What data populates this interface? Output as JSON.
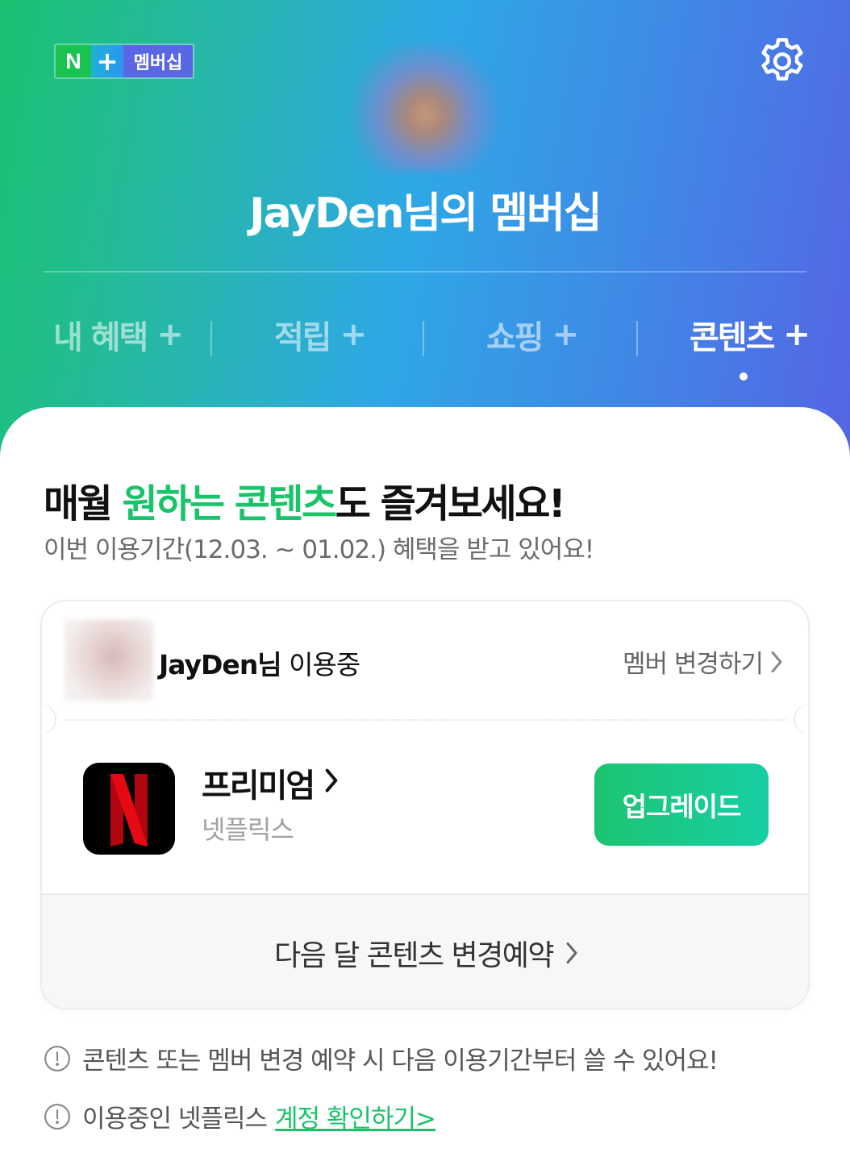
{
  "header": {
    "brand": {
      "n": "N",
      "plus": "+",
      "text": "멤버십"
    },
    "title": "JayDen님의 멤버십",
    "tabs": [
      {
        "label": "내 혜택",
        "plus": "+"
      },
      {
        "label": "적립",
        "plus": "+"
      },
      {
        "label": "쇼핑",
        "plus": "+"
      },
      {
        "label": "콘텐츠",
        "plus": "+",
        "active": true
      }
    ]
  },
  "content": {
    "headline_part1": "매월 ",
    "headline_highlight": "원하는 콘텐츠",
    "headline_part2": "도 즐겨보세요!",
    "subline": "이번 이용기간(12.03. ~ 01.02.) 혜택을 받고 있어요!",
    "card": {
      "member_name": "JayDen님",
      "member_status": " 이용중",
      "change_member": "멤버 변경하기",
      "plan_name": "프리미엄",
      "service_name": "넷플릭스",
      "upgrade_label": "업그레이드",
      "next_month_change": "다음 달 콘텐츠 변경예약"
    },
    "notices": [
      {
        "text": "콘텐츠 또는 멤버 변경 예약 시 다음 이용기간부터 쓸 수 있어요!"
      },
      {
        "text": "이용중인 넷플릭스",
        "link": "계정 확인하기>"
      }
    ]
  },
  "colors": {
    "accent_green": "#19c36a",
    "netflix_red": "#e50914"
  }
}
